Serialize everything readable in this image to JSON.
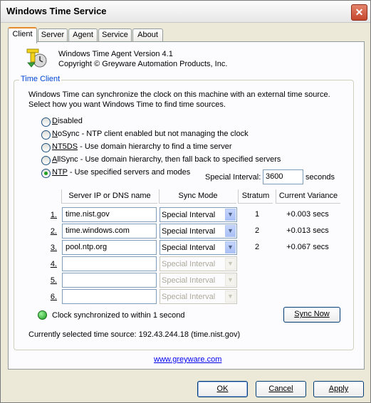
{
  "window": {
    "title": "Windows Time Service",
    "close_label": "✕"
  },
  "tabs": [
    {
      "label": "Client",
      "active": true
    },
    {
      "label": "Server"
    },
    {
      "label": "Agent"
    },
    {
      "label": "Service"
    },
    {
      "label": "About"
    }
  ],
  "about": {
    "version": "Windows Time Agent Version 4.1",
    "copyright": "Copyright ©  Greyware Automation Products, Inc."
  },
  "time_client": {
    "group_label": "Time Client",
    "description_line1": "Windows Time can synchronize the clock on this machine with an external time source.",
    "description_line2": "Select how you want Windows Time to find time sources.",
    "options": [
      {
        "key": "D",
        "rest": "isabled",
        "checked": false
      },
      {
        "key": "N",
        "rest": "oSync - NTP client enabled but not managing the clock",
        "checked": false
      },
      {
        "key": "NT5DS",
        "rest": " - Use domain hierarchy to find a time server",
        "checked": false
      },
      {
        "key": "A",
        "rest": "llSync - Use domain hierarchy, then fall back to specified servers",
        "checked": false
      },
      {
        "key": "NTP",
        "rest": " - Use specified servers and modes",
        "checked": true
      }
    ],
    "special_interval_label": "Special Interval:",
    "special_interval_value": "3600",
    "special_interval_unit": "seconds"
  },
  "table": {
    "headers": [
      "Server IP or DNS name",
      "Sync Mode",
      "Stratum",
      "Current Variance"
    ],
    "rows": [
      {
        "num": "1.",
        "server": "time.nist.gov",
        "mode": "Special Interval",
        "stratum": "1",
        "variance": "+0.003 secs",
        "enabled": true
      },
      {
        "num": "2.",
        "server": "time.windows.com",
        "mode": "Special Interval",
        "stratum": "2",
        "variance": "+0.013 secs",
        "enabled": true
      },
      {
        "num": "3.",
        "server": "pool.ntp.org",
        "mode": "Special Interval",
        "stratum": "2",
        "variance": "+0.067 secs",
        "enabled": true
      },
      {
        "num": "4.",
        "server": "",
        "mode": "Special Interval",
        "stratum": "",
        "variance": "",
        "enabled": false
      },
      {
        "num": "5.",
        "server": "",
        "mode": "Special Interval",
        "stratum": "",
        "variance": "",
        "enabled": false
      },
      {
        "num": "6.",
        "server": "",
        "mode": "Special Interval",
        "stratum": "",
        "variance": "",
        "enabled": false
      }
    ]
  },
  "status": {
    "sync_text": "Clock synchronized to within 1 second",
    "sync_button": "Sync Now",
    "source_text": "Currently selected time source: 192.43.244.18 (time.nist.gov)",
    "indicator_color": "#22aa22"
  },
  "footer": {
    "link": "www.greyware.com",
    "ok": "OK",
    "cancel": "Cancel",
    "apply": "Apply"
  }
}
